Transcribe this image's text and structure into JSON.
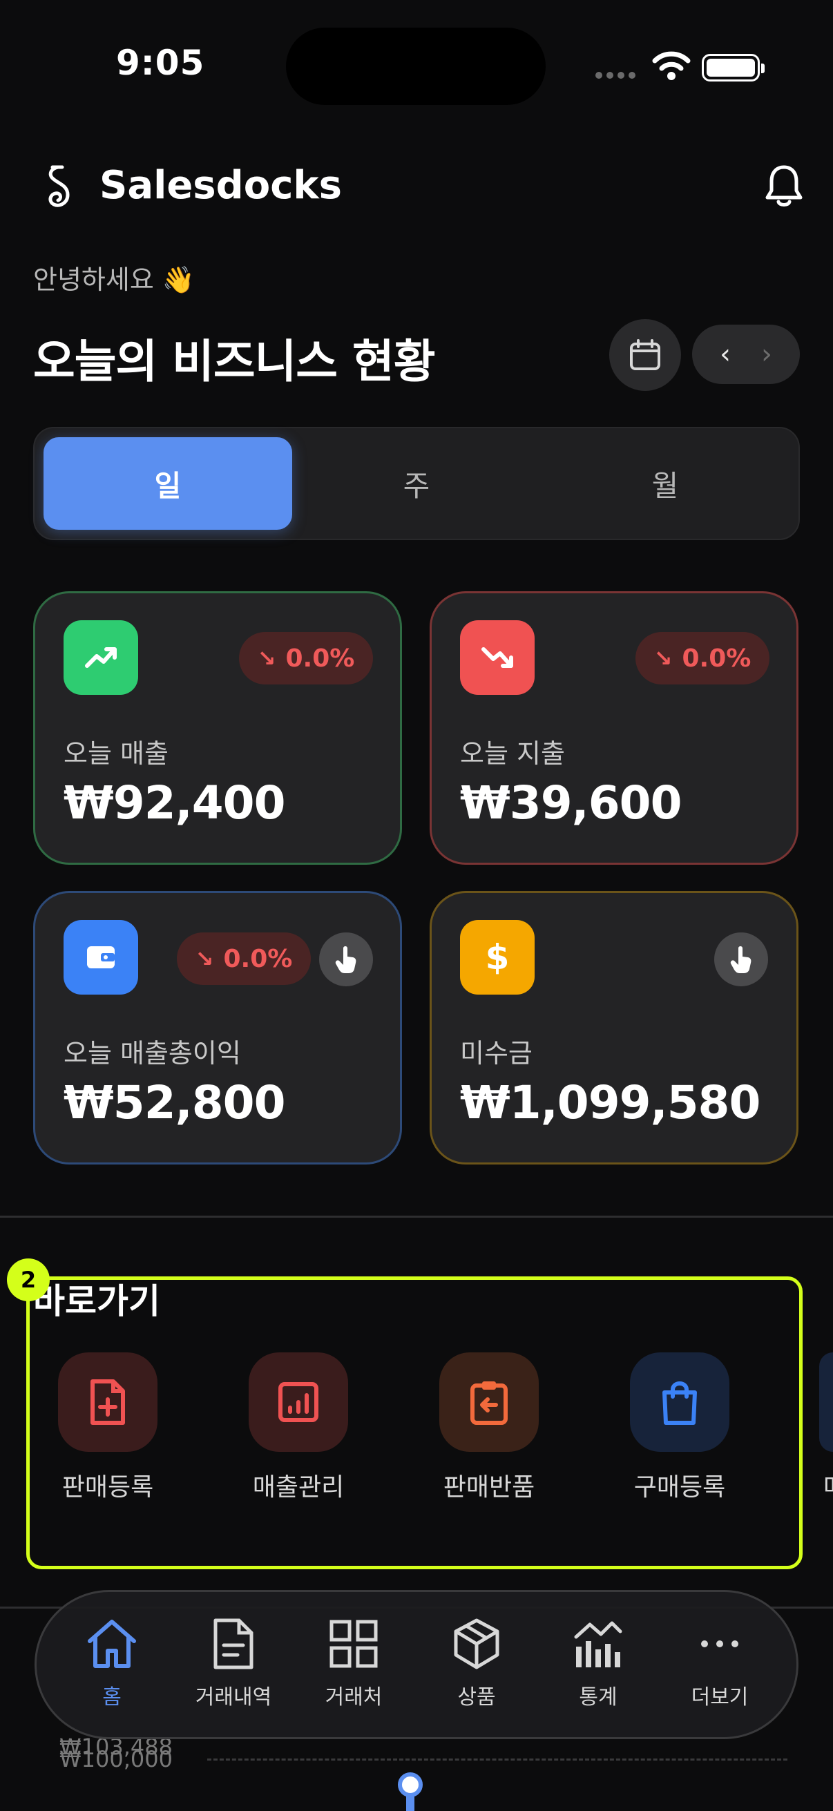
{
  "status_bar": {
    "time": "9:05"
  },
  "header": {
    "app_name": "Salesdocks"
  },
  "greeting": "안녕하세요 👋",
  "headline": "오늘의 비즈니스 현황",
  "period_tabs": {
    "day": "일",
    "week": "주",
    "month": "월",
    "selected": "일"
  },
  "cards": {
    "revenue": {
      "label": "오늘 매출",
      "value": "₩92,400",
      "change": "0.0%",
      "accent": "#2ecc71"
    },
    "expense": {
      "label": "오늘 지출",
      "value": "₩39,600",
      "change": "0.0%",
      "accent": "#f05252"
    },
    "gross_profit": {
      "label": "오늘 매출총이익",
      "value": "₩52,800",
      "change": "0.0%",
      "accent": "#3b82f6"
    },
    "receivable": {
      "label": "미수금",
      "value": "₩1,099,580",
      "accent": "#f5a700"
    }
  },
  "shortcuts": {
    "title": "바로가기",
    "marker": "2",
    "items": [
      {
        "label": "판매등록",
        "icon": "file-plus-icon"
      },
      {
        "label": "매출관리",
        "icon": "bar-chart-icon"
      },
      {
        "label": "판매반품",
        "icon": "clipboard-return-icon"
      },
      {
        "label": "구매등록",
        "icon": "shopping-bag-icon"
      }
    ],
    "partial_next": "매"
  },
  "background_values": {
    "a": "₩103,488",
    "b": "₩100,000"
  },
  "tabbar": {
    "items": [
      {
        "label": "홈",
        "icon": "home-icon",
        "active": true
      },
      {
        "label": "거래내역",
        "icon": "document-icon"
      },
      {
        "label": "거래처",
        "icon": "grid-icon"
      },
      {
        "label": "상품",
        "icon": "box-icon"
      },
      {
        "label": "통계",
        "icon": "stats-icon"
      },
      {
        "label": "더보기",
        "icon": "more-icon"
      }
    ]
  },
  "colors": {
    "primary": "#5b8ff0",
    "highlight": "#d4ff1a",
    "negative": "#f05a5a"
  }
}
